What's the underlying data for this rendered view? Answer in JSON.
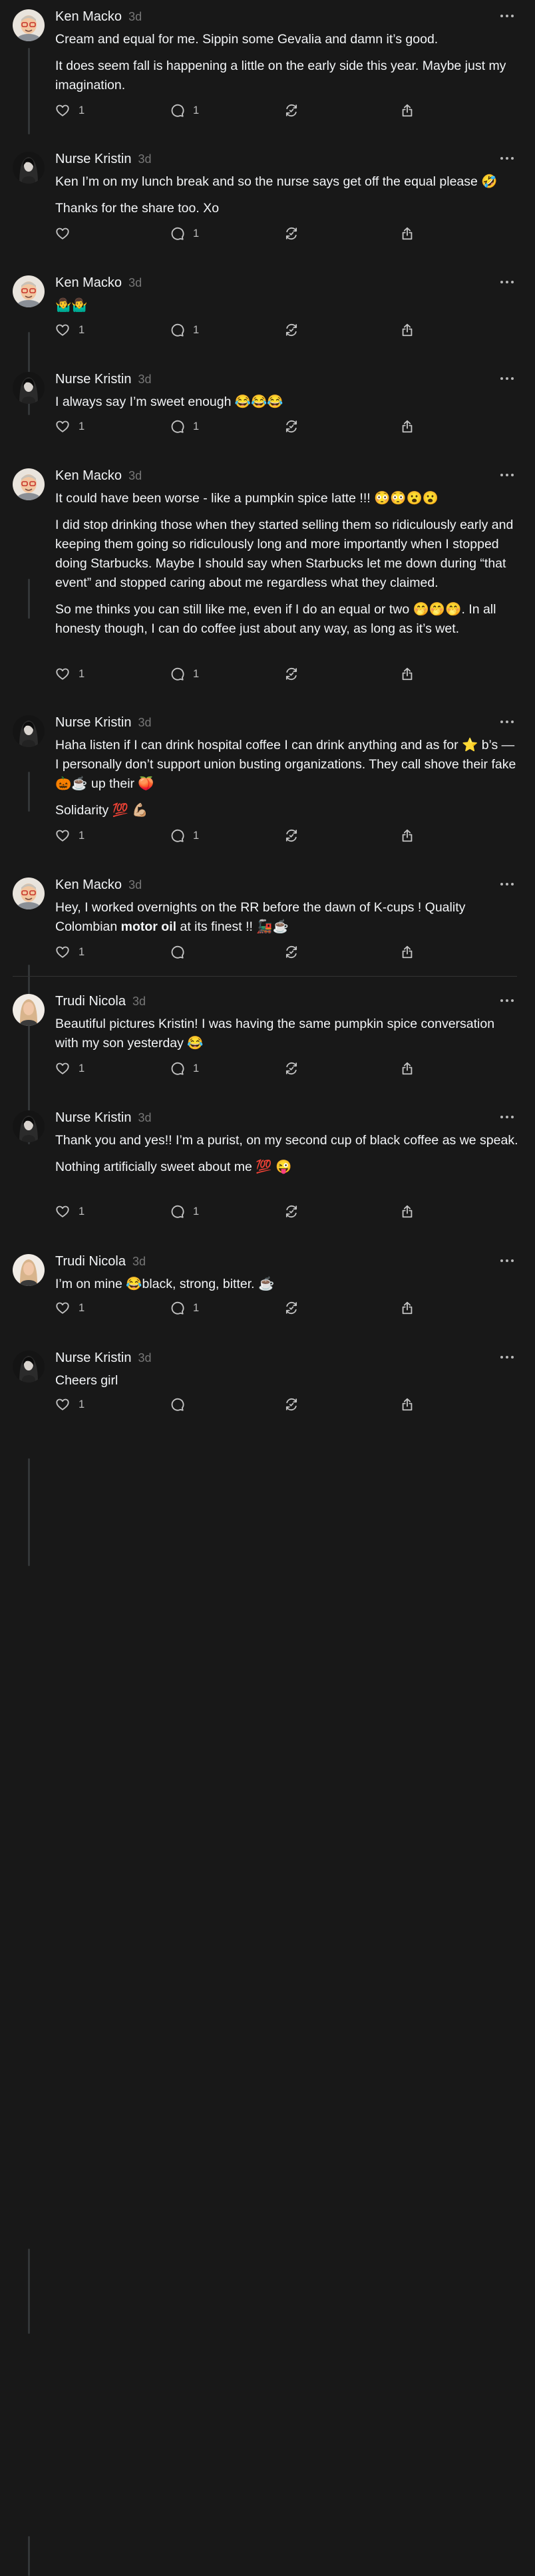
{
  "posts": [
    {
      "author": "Ken Macko",
      "time": "3d",
      "avatar": "ken",
      "paragraphs": [
        "Cream and equal for me. Sippin some Gevalia and damn it’s good.",
        "It does seem fall is happening a little on the early side this year. Maybe just my imagination."
      ],
      "likes": "1",
      "replies": "1"
    },
    {
      "author": "Nurse Kristin",
      "time": "3d",
      "avatar": "kristin",
      "paragraphs": [
        "Ken I’m on my lunch break and so the nurse says get off the equal please 🤣",
        "Thanks for the share too. Xo"
      ],
      "likes": "",
      "replies": "1"
    },
    {
      "author": "Ken Macko",
      "time": "3d",
      "avatar": "ken",
      "paragraphs": [
        "🤷‍♂️🤷‍♂️"
      ],
      "likes": "1",
      "replies": "1"
    },
    {
      "author": "Nurse Kristin",
      "time": "3d",
      "avatar": "kristin",
      "paragraphs": [
        "I always say I’m sweet enough 😂😂😂"
      ],
      "likes": "1",
      "replies": "1"
    },
    {
      "author": "Ken Macko",
      "time": "3d",
      "avatar": "ken",
      "paragraphs": [
        "It could have been worse - like a pumpkin spice latte !!! 😳😳😮😮",
        "I did stop drinking those when they started selling them so ridiculously early and keeping them going so ridiculously long and more importantly when I stopped doing Starbucks. Maybe I should say when Starbucks let me down during “that event” and stopped caring about me regardless what they claimed.",
        "So me thinks you can still like me, even if I do an equal or two 🤭🤭🤭. In all honesty though, I can do coffee just about any way, as long as it’s wet."
      ],
      "likes": "1",
      "replies": "1"
    },
    {
      "author": "Nurse Kristin",
      "time": "3d",
      "avatar": "kristin",
      "paragraphs": [
        "Haha listen if I can drink hospital coffee I can drink anything and as for ⭐️ b’s — I personally don’t support union busting organizations. They call shove their fake 🎃☕️ up their 🍑",
        "Solidarity 💯 💪🏼"
      ],
      "likes": "1",
      "replies": "1"
    },
    {
      "author": "Ken Macko",
      "time": "3d",
      "avatar": "ken",
      "rich": {
        "before": "Hey, I worked overnights on the RR before the dawn of K-cups ! Quality Colombian ",
        "bold": "motor oil",
        "after": " at its finest !! 🚂☕️"
      },
      "likes": "1",
      "replies": ""
    },
    {
      "author": "Trudi Nicola",
      "time": "3d",
      "avatar": "trudi",
      "paragraphs": [
        "Beautiful pictures Kristin! I was having the same pumpkin spice conversation with my son yesterday 😂"
      ],
      "likes": "1",
      "replies": "1"
    },
    {
      "author": "Nurse Kristin",
      "time": "3d",
      "avatar": "kristin",
      "paragraphs": [
        "Thank you and yes!! I’m a purist, on my second cup of black coffee as we speak.",
        "Nothing artificially sweet about me 💯 😜"
      ],
      "likes": "1",
      "replies": "1"
    },
    {
      "author": "Trudi Nicola",
      "time": "3d",
      "avatar": "trudi",
      "paragraphs": [
        "I’m on mine 😂black, strong, bitter. ☕️"
      ],
      "likes": "1",
      "replies": "1"
    },
    {
      "author": "Nurse Kristin",
      "time": "3d",
      "avatar": "kristin",
      "paragraphs": [
        "Cheers girl"
      ],
      "likes": "1",
      "replies": ""
    }
  ],
  "colors": {
    "background": "#181818",
    "text": "#f3f5f7",
    "muted": "#777777",
    "line": "#333638"
  },
  "icons": {
    "like": "heart-icon",
    "reply": "comment-icon",
    "repost": "repost-icon",
    "share": "share-icon",
    "more": "more-icon"
  }
}
